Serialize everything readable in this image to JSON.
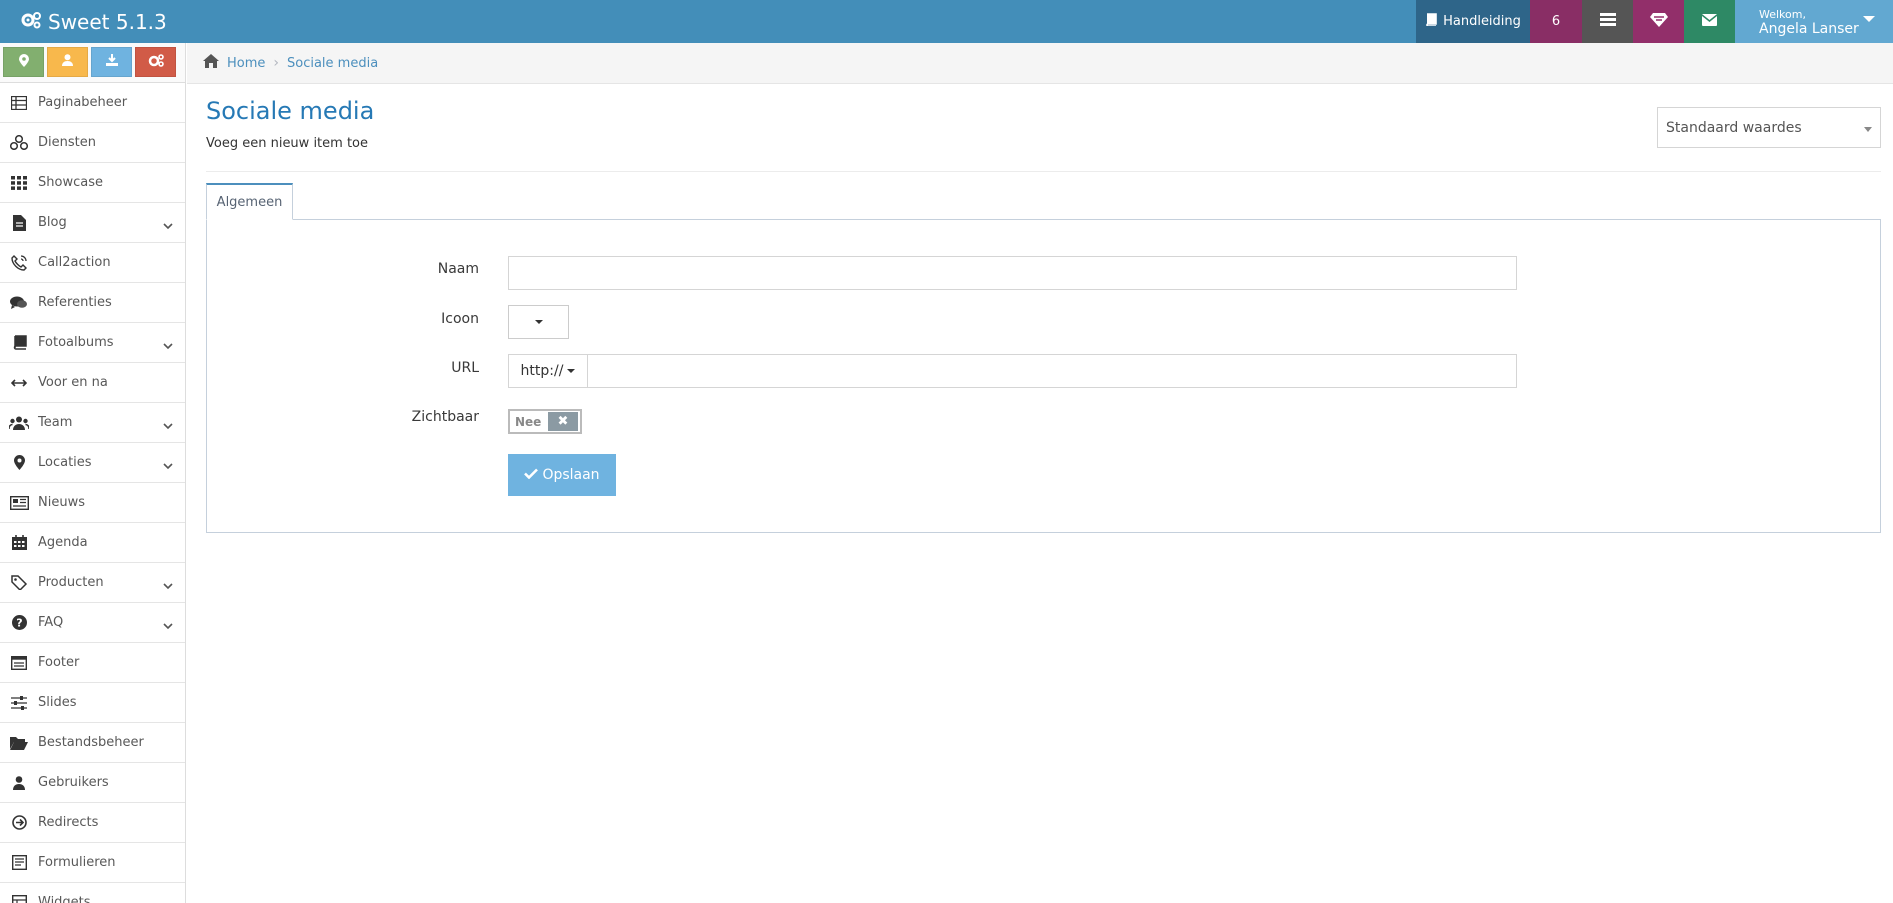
{
  "app": {
    "title": "Sweet 5.1.3"
  },
  "topbar": {
    "manual_label": "Handleiding",
    "notification_count": "6",
    "welcome_label": "Welkom,",
    "user_name": "Angela Lanser"
  },
  "sidebar": {
    "items": [
      {
        "label": "Paginabeheer",
        "icon": "table-icon",
        "submenu": false
      },
      {
        "label": "Diensten",
        "icon": "cubes-icon",
        "submenu": false
      },
      {
        "label": "Showcase",
        "icon": "grid-icon",
        "submenu": false
      },
      {
        "label": "Blog",
        "icon": "document-icon",
        "submenu": true
      },
      {
        "label": "Call2action",
        "icon": "phone-icon",
        "submenu": false
      },
      {
        "label": "Referenties",
        "icon": "comments-icon",
        "submenu": false
      },
      {
        "label": "Fotoalbums",
        "icon": "book-icon",
        "submenu": true
      },
      {
        "label": "Voor en na",
        "icon": "arrows-horizontal-icon",
        "submenu": false
      },
      {
        "label": "Team",
        "icon": "users-icon",
        "submenu": true
      },
      {
        "label": "Locaties",
        "icon": "map-marker-icon",
        "submenu": true
      },
      {
        "label": "Nieuws",
        "icon": "newspaper-icon",
        "submenu": false
      },
      {
        "label": "Agenda",
        "icon": "calendar-icon",
        "submenu": false
      },
      {
        "label": "Producten",
        "icon": "tags-icon",
        "submenu": true
      },
      {
        "label": "FAQ",
        "icon": "question-icon",
        "submenu": true
      },
      {
        "label": "Footer",
        "icon": "footer-icon",
        "submenu": false
      },
      {
        "label": "Slides",
        "icon": "sliders-icon",
        "submenu": false
      },
      {
        "label": "Bestandsbeheer",
        "icon": "folder-open-icon",
        "submenu": false
      },
      {
        "label": "Gebruikers",
        "icon": "user-icon",
        "submenu": false
      },
      {
        "label": "Redirects",
        "icon": "arrow-circle-icon",
        "submenu": false
      },
      {
        "label": "Formulieren",
        "icon": "form-icon",
        "submenu": false
      },
      {
        "label": "Widgets",
        "icon": "widget-icon",
        "submenu": false
      }
    ]
  },
  "breadcrumb": {
    "home": "Home",
    "current": "Sociale media"
  },
  "page": {
    "title": "Sociale media",
    "subtitle": "Voeg een nieuw item toe",
    "defaults_select": "Standaard waardes"
  },
  "tabs": [
    {
      "label": "Algemeen",
      "active": true
    }
  ],
  "form": {
    "name_label": "Naam",
    "name_value": "",
    "icon_label": "Icoon",
    "url_label": "URL",
    "url_protocol": "http://",
    "url_value": "",
    "visible_label": "Zichtbaar",
    "visible_state": "Nee",
    "save_label": "Opslaan"
  },
  "colors": {
    "topbar": "#438eb9",
    "accent_blue": "#6fb3e0",
    "title_blue": "#2679b5",
    "shortcut_green": "#82af6f",
    "shortcut_orange": "#f8b84c",
    "shortcut_red": "#d15b47"
  }
}
